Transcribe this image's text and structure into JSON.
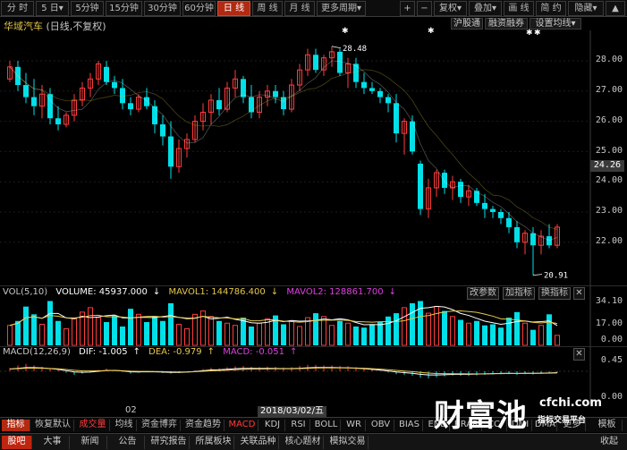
{
  "toolbar": {
    "left": [
      "分 时",
      "5 日▾",
      "5分钟",
      "15分钟",
      "30分钟",
      "60分钟",
      "日 线",
      "周 线",
      "月 线",
      "更多周期▾"
    ],
    "active_index": 6,
    "right": [
      "+",
      "−",
      "复权▾",
      "叠加▾",
      "画 线",
      "简 约",
      "隐藏▾",
      "▲"
    ]
  },
  "stock": {
    "name": "华域汽车",
    "mode": "(日线,不复权)"
  },
  "top_tags": [
    "沪股通",
    "融资融券",
    "设置均线▾"
  ],
  "price_axis": {
    "labels": [
      "28.00",
      "27.00",
      "26.00",
      "25.00",
      "24.00",
      "23.00",
      "22.00"
    ],
    "values": [
      28,
      27,
      26,
      25,
      24,
      23,
      22
    ],
    "current": "24.26",
    "max_label": "28.48",
    "min_label": "20.91"
  },
  "chart_data": {
    "type": "candlestick",
    "date_cursor": "2018/03/02/五",
    "month_label": "02",
    "ohlc": [
      [
        27.4,
        28.0,
        27.3,
        27.8
      ],
      [
        27.8,
        28.0,
        27.0,
        27.2
      ],
      [
        27.2,
        27.6,
        26.6,
        26.8
      ],
      [
        26.8,
        27.4,
        26.2,
        26.5
      ],
      [
        26.5,
        27.2,
        26.1,
        26.9
      ],
      [
        26.9,
        27.1,
        25.9,
        26.1
      ],
      [
        26.1,
        26.5,
        25.7,
        25.9
      ],
      [
        25.9,
        26.3,
        25.8,
        26.2
      ],
      [
        26.2,
        26.9,
        26.0,
        26.7
      ],
      [
        26.7,
        27.3,
        26.5,
        27.1
      ],
      [
        27.1,
        27.6,
        26.8,
        27.4
      ],
      [
        27.4,
        28.0,
        27.2,
        27.9
      ],
      [
        27.8,
        28.0,
        27.2,
        27.3
      ],
      [
        27.3,
        27.5,
        26.9,
        27.1
      ],
      [
        27.1,
        27.4,
        26.4,
        26.6
      ],
      [
        26.6,
        26.8,
        26.2,
        26.4
      ],
      [
        26.4,
        26.9,
        26.3,
        26.8
      ],
      [
        26.8,
        27.1,
        26.4,
        26.5
      ],
      [
        26.5,
        26.7,
        25.6,
        25.9
      ],
      [
        25.9,
        26.2,
        25.2,
        25.5
      ],
      [
        25.5,
        26.0,
        24.1,
        24.5
      ],
      [
        24.5,
        25.4,
        24.3,
        25.1
      ],
      [
        25.1,
        25.6,
        24.8,
        25.4
      ],
      [
        25.4,
        26.2,
        25.3,
        26.0
      ],
      [
        26.0,
        26.6,
        25.7,
        26.3
      ],
      [
        26.3,
        26.9,
        25.9,
        26.7
      ],
      [
        26.7,
        27.1,
        26.2,
        26.4
      ],
      [
        26.4,
        27.3,
        26.3,
        27.1
      ],
      [
        27.1,
        27.7,
        26.8,
        27.4
      ],
      [
        27.4,
        27.5,
        26.6,
        26.8
      ],
      [
        26.8,
        27.2,
        26.1,
        26.3
      ],
      [
        26.3,
        27.0,
        26.1,
        26.8
      ],
      [
        26.8,
        27.2,
        26.5,
        27.0
      ],
      [
        27.0,
        27.2,
        26.6,
        26.8
      ],
      [
        26.8,
        27.0,
        26.2,
        26.4
      ],
      [
        26.4,
        27.4,
        26.3,
        27.2
      ],
      [
        27.2,
        27.9,
        27.0,
        27.7
      ],
      [
        27.7,
        28.4,
        27.5,
        28.2
      ],
      [
        28.2,
        28.4,
        27.6,
        27.7
      ],
      [
        27.7,
        28.2,
        27.5,
        28.1
      ],
      [
        28.1,
        28.48,
        27.8,
        28.3
      ],
      [
        28.3,
        28.4,
        27.5,
        27.6
      ],
      [
        27.6,
        28.1,
        27.1,
        27.9
      ],
      [
        27.9,
        28.1,
        27.1,
        27.3
      ],
      [
        27.3,
        27.6,
        26.9,
        27.1
      ],
      [
        27.1,
        27.3,
        26.9,
        27.0
      ],
      [
        27.0,
        27.1,
        26.6,
        26.8
      ],
      [
        26.8,
        26.9,
        26.3,
        26.6
      ],
      [
        26.6,
        26.9,
        25.3,
        25.6
      ],
      [
        25.6,
        26.1,
        24.9,
        26.0
      ],
      [
        26.0,
        26.2,
        24.9,
        25.0
      ],
      [
        24.6,
        24.7,
        22.9,
        23.1
      ],
      [
        23.1,
        24.1,
        22.8,
        23.8
      ],
      [
        23.8,
        24.4,
        23.5,
        24.3
      ],
      [
        24.3,
        24.4,
        23.6,
        23.8
      ],
      [
        23.8,
        24.2,
        23.4,
        24.0
      ],
      [
        24.0,
        24.1,
        23.3,
        23.5
      ],
      [
        23.5,
        23.9,
        23.2,
        23.7
      ],
      [
        23.7,
        23.8,
        23.2,
        23.3
      ],
      [
        23.3,
        23.6,
        22.8,
        23.1
      ],
      [
        23.1,
        23.2,
        22.8,
        23.0
      ],
      [
        23.0,
        23.1,
        22.6,
        22.8
      ],
      [
        22.8,
        23.0,
        22.3,
        22.5
      ],
      [
        22.5,
        22.7,
        21.8,
        22.0
      ],
      [
        22.0,
        22.4,
        21.6,
        22.3
      ],
      [
        22.3,
        22.5,
        20.91,
        21.9
      ],
      [
        21.9,
        22.4,
        21.6,
        22.2
      ],
      [
        22.2,
        22.6,
        21.8,
        21.9
      ],
      [
        21.9,
        22.6,
        21.8,
        22.5
      ]
    ],
    "ma_up": "#e0e0e0",
    "ma_dn": "#d4c233",
    "volume": [
      18,
      22,
      35,
      28,
      19,
      40,
      22,
      15,
      24,
      30,
      34,
      25,
      21,
      27,
      17,
      33,
      28,
      21,
      26,
      22,
      38,
      19,
      15,
      28,
      31,
      26,
      22,
      20,
      18,
      25,
      17,
      20,
      24,
      27,
      19,
      22,
      17,
      25,
      29,
      26,
      18,
      22,
      20,
      17,
      16,
      19,
      21,
      26,
      29,
      34,
      38,
      40,
      29,
      35,
      31,
      26,
      23,
      20,
      22,
      18,
      19,
      16,
      25,
      30,
      20,
      14,
      18,
      28,
      9
    ],
    "macd": [
      0.12,
      0.2,
      0.25,
      0.2,
      0.15,
      0.1,
      0.05,
      -0.05,
      -0.12,
      -0.08,
      -0.02,
      0.05,
      0.09,
      0.05,
      -0.02,
      -0.08,
      -0.05,
      -0.01,
      -0.03,
      -0.06,
      -0.08,
      -0.06,
      -0.02,
      0.03,
      0.08,
      0.12,
      0.1,
      0.14,
      0.17,
      0.18,
      0.15,
      0.14,
      0.16,
      0.15,
      0.13,
      0.14,
      0.18,
      0.22,
      0.22,
      0.2,
      0.2,
      0.18,
      0.17,
      0.14,
      0.11,
      0.06,
      0.02,
      -0.04,
      -0.1,
      -0.12,
      -0.15,
      -0.22,
      -0.24,
      -0.2,
      -0.17,
      -0.14,
      -0.15,
      -0.16,
      -0.14,
      -0.12,
      -0.11,
      -0.1,
      -0.1,
      -0.12,
      -0.1,
      -0.11,
      -0.09,
      -0.07,
      -0.05
    ]
  },
  "vol": {
    "name": "VOL(5,10)",
    "volume": "VOLUME: 45937.000",
    "mavol1": "MAVOL1: 144786.400",
    "mavol2": "MAVOL2: 128861.700",
    "axis": [
      "34.10",
      "17.00",
      "0.00"
    ],
    "btn_param": "改参数",
    "btn_add": "加指标",
    "btn_swap": "换指标",
    "btn_close": "✕"
  },
  "macd": {
    "name": "MACD(12,26,9)",
    "dif": "DIF: -1.005",
    "dea": "DEA: -0.979",
    "macd": "MACD: -0.051",
    "axis": [
      "0.45",
      "0.00"
    ],
    "btn_close": "✕"
  },
  "ind_tabs": [
    "指标",
    "恢复默认",
    "成交量",
    "均线",
    "资金博弈",
    "资金趋势",
    "MACD",
    "KDJ",
    "RSI",
    "BOLL",
    "WR",
    "OBV",
    "BIAS",
    "ENE",
    "BRAR",
    "CCI",
    "DMI",
    "DMA",
    "更多",
    "模板"
  ],
  "bottom_nav": [
    "股吧",
    "大事",
    "新闻",
    "公告",
    "研究报告",
    "所属板块",
    "关联品种",
    "核心题材",
    "模拟交易"
  ],
  "bottom_nav_right": "收起",
  "watermark": {
    "main": "财富池",
    "url": "cfchi.com",
    "sub": "指标交易平台"
  }
}
